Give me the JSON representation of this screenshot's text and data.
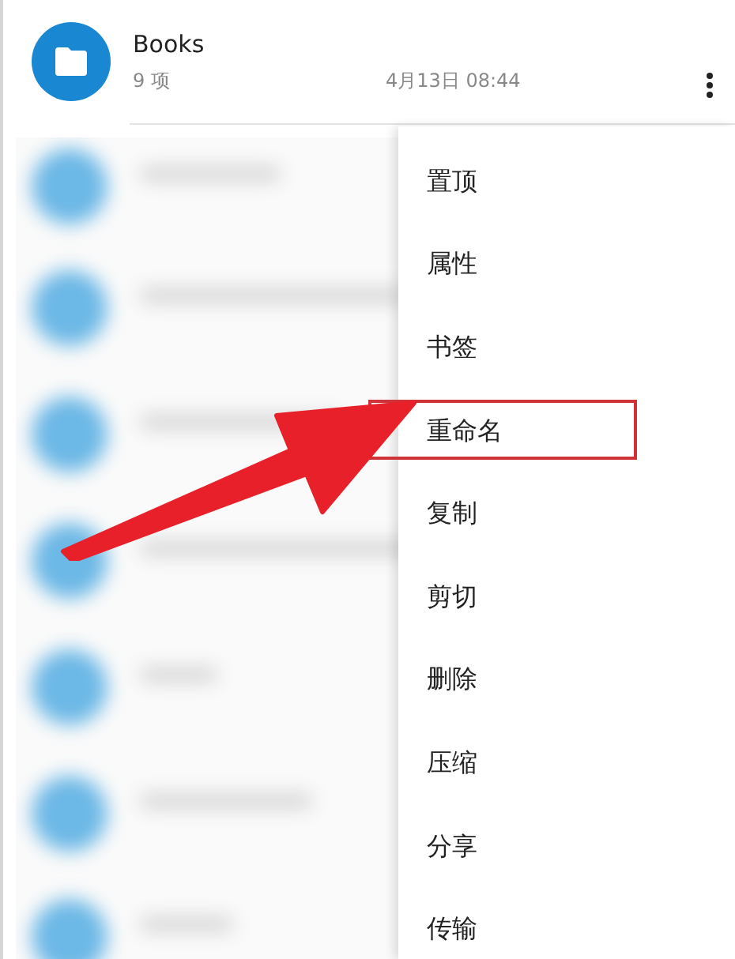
{
  "folder": {
    "name": "Books",
    "count": "9 项",
    "modified": "4月13日 08:44"
  },
  "menu": {
    "items": [
      {
        "label": "置顶",
        "highlighted": false
      },
      {
        "label": "属性",
        "highlighted": false
      },
      {
        "label": "书签",
        "highlighted": false
      },
      {
        "label": "重命名",
        "highlighted": true
      },
      {
        "label": "复制",
        "highlighted": false
      },
      {
        "label": "剪切",
        "highlighted": false
      },
      {
        "label": "删除",
        "highlighted": false
      },
      {
        "label": "压缩",
        "highlighted": false
      },
      {
        "label": "分享",
        "highlighted": false
      },
      {
        "label": "传输",
        "highlighted": false
      }
    ]
  }
}
